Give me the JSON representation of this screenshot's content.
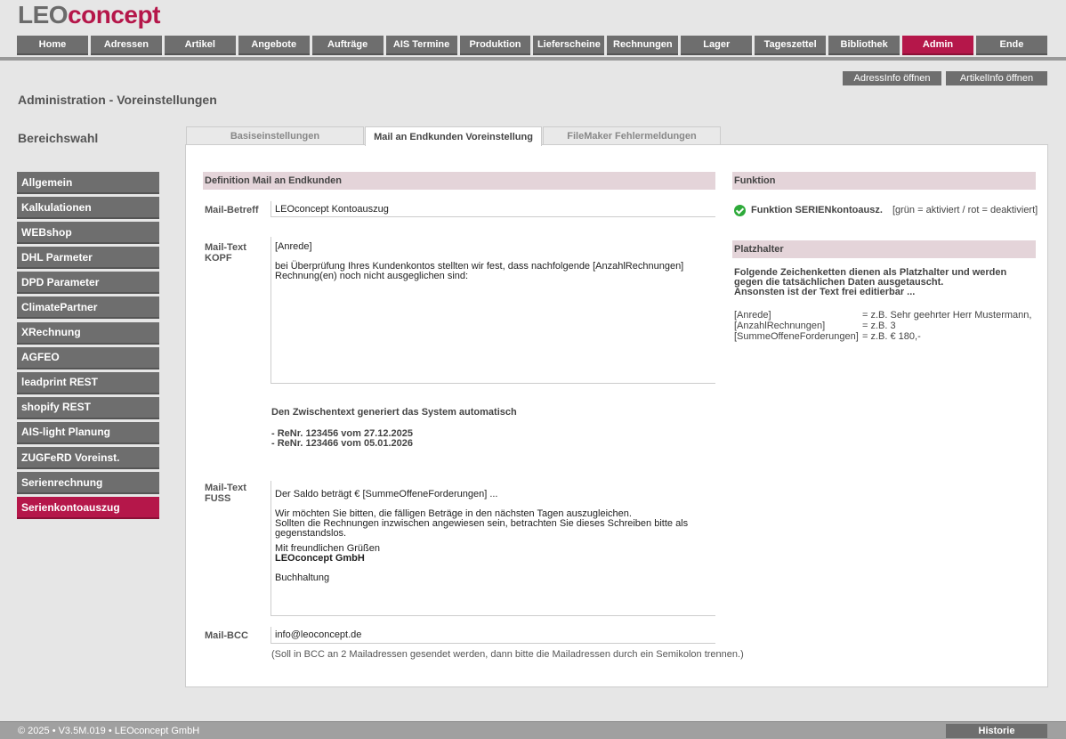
{
  "logo": {
    "part1": "LEO",
    "part2": "concept"
  },
  "nav": [
    "Home",
    "Adressen",
    "Artikel",
    "Angebote",
    "Aufträge",
    "AIS Termine",
    "Produktion",
    "Lieferscheine",
    "Rechnungen",
    "Lager",
    "Tageszettel",
    "Bibliothek",
    "Admin",
    "Ende"
  ],
  "nav_active": "Admin",
  "top_buttons": {
    "adress": "AdressInfo öffnen",
    "artikel": "ArtikelInfo öffnen"
  },
  "page_title": "Administration - Voreinstellungen",
  "section_title": "Bereichswahl",
  "sidebar": [
    "Allgemein",
    "Kalkulationen",
    "WEBshop",
    "DHL Parmeter",
    "DPD Parameter",
    "ClimatePartner",
    "XRechnung",
    "AGFEO",
    "leadprint REST",
    "shopify REST",
    "AIS-light Planung",
    "ZUGFeRD Voreinst.",
    "Serienrechnung",
    "Serienkontoauszug"
  ],
  "sidebar_active": "Serienkontoauszug",
  "tabs": {
    "basis": "Basiseinstellungen",
    "mail": "Mail an Endkunden Voreinstellung",
    "filemaker": "FileMaker Fehlermeldungen"
  },
  "definition": {
    "header": "Definition Mail an Endkunden",
    "betreff_label": "Mail-Betreff",
    "betreff_value": "LEOconcept Kontoauszug",
    "kopf_label_1": "Mail-Text",
    "kopf_label_2": "KOPF",
    "kopf_line1": "[Anrede]",
    "kopf_line2": "bei Überprüfung Ihres Kundenkontos stellten wir fest, dass nachfolgende [AnzahlRechnungen]",
    "kopf_line3": "Rechnung(en) noch nicht ausgeglichen sind:",
    "zwischen_title": "Den Zwischentext generiert das System automatisch",
    "zwischen_line1": "- ReNr. 123456 vom 27.12.2025",
    "zwischen_line2": "- ReNr. 123466 vom 05.01.2026",
    "fuss_label_1": "Mail-Text",
    "fuss_label_2": "FUSS",
    "fuss_line1": "Der Saldo beträgt € [SummeOffeneForderungen] ...",
    "fuss_line2": "Wir möchten Sie bitten, die fälligen Beträge in den nächsten Tagen auszugleichen.",
    "fuss_line3": "Sollten die Rechnungen inzwischen angewiesen sein, betrachten Sie dieses Schreiben bitte als",
    "fuss_line4": "gegenstandslos.",
    "fuss_line5": "Mit freundlichen Grüßen",
    "fuss_line6": "LEOconcept GmbH",
    "fuss_line7": "Buchhaltung",
    "bcc_label": "Mail-BCC",
    "bcc_value": "info@leoconcept.de",
    "bcc_hint": "(Soll in BCC an 2 Mailadressen gesendet werden, dann bitte die Mailadressen durch ein Semikolon trennen.)"
  },
  "funktion": {
    "header": "Funktion",
    "name": "Funktion SERIENkontoausz.",
    "hint": "[grün = aktiviert / rot = deaktiviert]",
    "status_color": "#2eaa3a"
  },
  "platzhalter": {
    "header": "Platzhalter",
    "intro1": "Folgende Zeichenketten dienen als Platzhalter und werden",
    "intro2": "gegen die tatsächlichen Daten ausgetauscht.",
    "intro3": "Ansonsten ist der Text frei editierbar ...",
    "items": [
      {
        "key": "[Anrede]",
        "value": "= z.B. Sehr geehrter Herr Mustermann,"
      },
      {
        "key": "[AnzahlRechnungen]",
        "value": "= z.B. 3"
      },
      {
        "key": "[SummeOffeneForderungen]",
        "value": "= z.B. € 180,-"
      }
    ]
  },
  "footer": {
    "text": "© 2025 • V3.5M.019 • LEOconcept GmbH",
    "historie": "Historie"
  },
  "colors": {
    "accent": "#b5174a",
    "button": "#6e6e6e",
    "header_bar": "#e4d4d9"
  }
}
